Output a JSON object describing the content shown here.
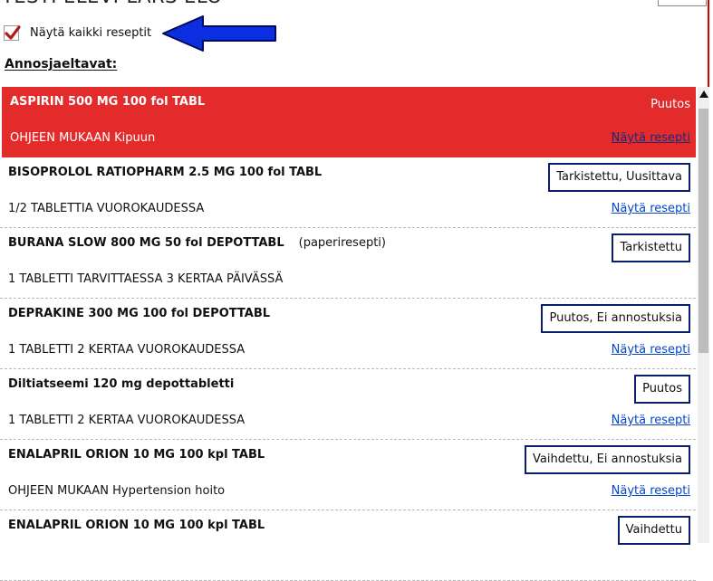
{
  "header": {
    "title_partial": "TESTI ELEVI-LARS ELO"
  },
  "filter": {
    "show_all_label": "Näytä kaikki reseptit",
    "checked": true
  },
  "section": {
    "heading": "Annosjaeltavat:"
  },
  "medications": [
    {
      "name": "ASPIRIN 500 MG 100 fol TABL",
      "note": "",
      "dosage": "OHJEEN MUKAAN  Kipuun",
      "status": "Puutos",
      "link": "Näytä resepti",
      "alert": true
    },
    {
      "name": "BISOPROLOL RATIOPHARM 2.5 MG 100 fol TABL",
      "note": "",
      "dosage": "1/2 TABLETTIA VUOROKAUDESSA",
      "status": "Tarkistettu, Uusittava",
      "link": "Näytä resepti",
      "alert": false
    },
    {
      "name": "BURANA SLOW 800 MG 50 fol DEPOTTABL",
      "note": "(paperiresepti)",
      "dosage": "1 TABLETTI TARVITTAESSA 3 KERTAA PÄIVÄSSÄ",
      "status": "Tarkistettu",
      "link": "",
      "alert": false
    },
    {
      "name": "DEPRAKINE 300 MG 100 fol DEPOTTABL",
      "note": "",
      "dosage": "1 TABLETTI 2 KERTAA VUOROKAUDESSA",
      "status": "Puutos, Ei annostuksia",
      "link": "Näytä resepti",
      "alert": false
    },
    {
      "name": "Diltiatseemi 120 mg depottabletti",
      "note": "",
      "dosage": "1 TABLETTI 2 KERTAA VUOROKAUDESSA",
      "status": "Puutos",
      "link": "Näytä resepti",
      "alert": false
    },
    {
      "name": "ENALAPRIL ORION 10 MG 100 kpl TABL",
      "note": "",
      "dosage": "OHJEEN MUKAAN  Hypertension hoito",
      "status": "Vaihdettu, Ei annostuksia",
      "link": "Näytä resepti",
      "alert": false
    },
    {
      "name": "ENALAPRIL ORION 10 MG 100 kpl TABL",
      "note": "",
      "dosage": "",
      "status": "Vaihdettu",
      "link": "",
      "alert": false
    }
  ],
  "colors": {
    "alert_row": "#e32b2b",
    "status_border": "#0a1e6e",
    "link": "#0645c8",
    "checkmark": "#b01c1c",
    "arrow": "#0a2ee0"
  },
  "icons": {
    "checkbox": "checkmark-icon",
    "arrow": "left-arrow-icon",
    "scroll_up": "caret-up-icon"
  }
}
